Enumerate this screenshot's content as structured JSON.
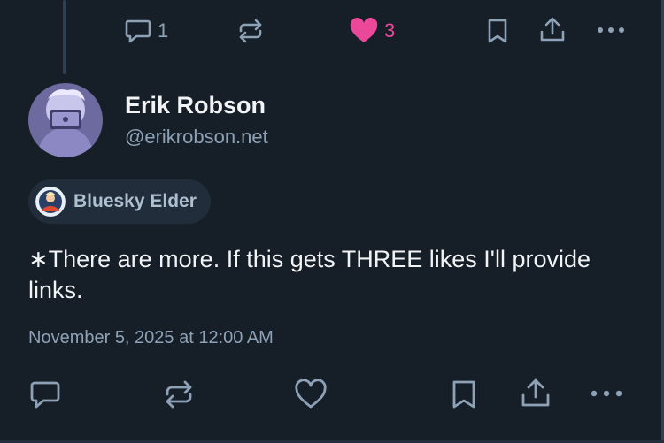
{
  "colors": {
    "background": "#161e27",
    "text_primary": "#f1f3f5",
    "text_secondary": "#8ea2b7",
    "like_active": "#ec4899",
    "badge_bg": "#212d3b"
  },
  "parent_post": {
    "reply_count": "1",
    "like_count": "3",
    "liked": true,
    "icons": [
      "reply-icon",
      "repost-icon",
      "heart-filled-icon",
      "bookmark-icon",
      "share-icon",
      "more-icon"
    ]
  },
  "post": {
    "author": {
      "display_name": "Erik Robson",
      "handle": "@erikrobson.net"
    },
    "badge": {
      "label": "Bluesky Elder"
    },
    "text": "∗There are more. If this gets THREE likes I'll provide links.",
    "timestamp": "November 5, 2025 at 12:00 AM",
    "icons": [
      "reply-icon",
      "repost-icon",
      "heart-outline-icon",
      "bookmark-icon",
      "share-icon",
      "more-icon"
    ]
  }
}
